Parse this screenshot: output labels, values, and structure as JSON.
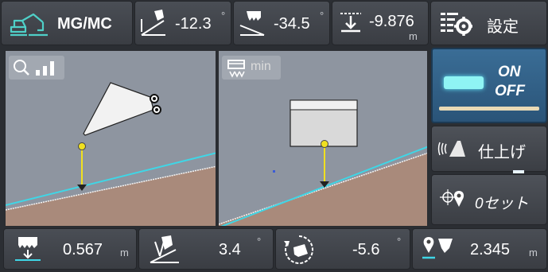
{
  "header": {
    "mode_title": "MG/MC",
    "pitch_value": "-12.3",
    "pitch_unit": "°",
    "bucket_angle_value": "-34.5",
    "bucket_angle_unit": "°",
    "depth_value": "-9.876",
    "depth_unit": "m",
    "settings_label": "設定"
  },
  "views": {
    "left_zoom_icon": "zoom-icon",
    "right_view_label": "min"
  },
  "side": {
    "on_label": "ON",
    "off_label": "OFF",
    "finish_label": "仕上げ",
    "zero_set_label": "0セット"
  },
  "footer": {
    "elevation_value": "0.567",
    "elevation_unit": "m",
    "tilt_value": "3.4",
    "tilt_unit": "°",
    "rotate_value": "-5.6",
    "rotate_unit": "°",
    "target_value": "2.345",
    "target_unit": "m"
  },
  "colors": {
    "accent_cyan": "#3fd6e6",
    "indicator_yellow": "#f0e020",
    "ground_brown": "#a98a7b",
    "panel_gray": "#8e95a0",
    "active_button_blue": "#2f5f86"
  }
}
